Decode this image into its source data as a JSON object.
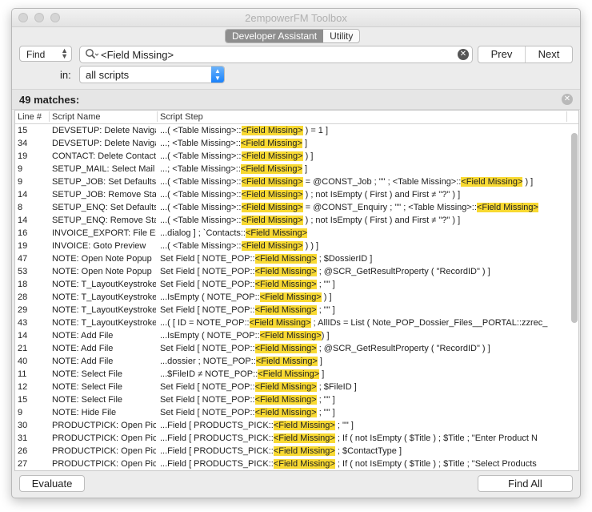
{
  "window": {
    "title": "2empowerFM Toolbox"
  },
  "tabs": [
    {
      "label": "Developer Assistant",
      "selected": true
    },
    {
      "label": "Utility",
      "selected": false
    }
  ],
  "find": {
    "mode": "Find",
    "query": "<Field Missing>",
    "prev_label": "Prev",
    "next_label": "Next",
    "in_label": "in:",
    "scope": "all scripts"
  },
  "results": {
    "count_label": "49 matches:",
    "columns": [
      "Line #",
      "Script Name",
      "Script Step"
    ],
    "highlight": "<Field Missing>",
    "highlight_color": "#f8d932",
    "rows": [
      {
        "line": "15",
        "name": "DEVSETUP: Delete Navigation",
        "step": "...( <Table Missing>::<Field Missing> ) = 1 ]"
      },
      {
        "line": "34",
        "name": "DEVSETUP: Delete Navigation",
        "step": "...; <Table Missing>::<Field Missing> ]"
      },
      {
        "line": "19",
        "name": "CONTACT: Delete Contact",
        "step": "...( <Table Missing>::<Field Missing> ) ]"
      },
      {
        "line": "9",
        "name": "SETUP_MAIL: Select Mail",
        "step": "...; <Table Missing>::<Field Missing> ]"
      },
      {
        "line": "9",
        "name": "SETUP_JOB: Set Defaults",
        "step": "...( <Table Missing>::<Field Missing> = @CONST_Job ; \"\" ; <Table Missing>::<Field Missing> ) ]"
      },
      {
        "line": "14",
        "name": "SETUP_JOB: Remove Status",
        "step": "...( <Table Missing>::<Field Missing> ) ; not IsEmpty ( First ) and First ≠ \"?\" ) ]"
      },
      {
        "line": "8",
        "name": "SETUP_ENQ: Set Defaults",
        "step": "...( <Table Missing>::<Field Missing> = @CONST_Enquiry ; \"\" ; <Table Missing>::<Field Missing>"
      },
      {
        "line": "14",
        "name": "SETUP_ENQ: Remove Status",
        "step": "...( <Table Missing>::<Field Missing> ) ; not IsEmpty ( First ) and First ≠ \"?\" ) ]"
      },
      {
        "line": "16",
        "name": "INVOICE_EXPORT: File Export",
        "step": "...dialog ] ; `Contacts::<Field Missing>"
      },
      {
        "line": "19",
        "name": "INVOICE: Goto Preview",
        "step": "...( <Table Missing>::<Field Missing> ) ) ]"
      },
      {
        "line": "47",
        "name": "NOTE: Open Note Popup",
        "step": "Set Field [ NOTE_POP::<Field Missing> ; $DossierID ]"
      },
      {
        "line": "53",
        "name": "NOTE: Open Note Popup",
        "step": "Set Field [ NOTE_POP::<Field Missing> ; @SCR_GetResultProperty ( \"RecordID\" ) ]"
      },
      {
        "line": "18",
        "name": "NOTE: T_LayoutKeystroke",
        "step": "Set Field [ NOTE_POP::<Field Missing> ; \"\" ]"
      },
      {
        "line": "28",
        "name": "NOTE: T_LayoutKeystroke",
        "step": "...IsEmpty ( NOTE_POP::<Field Missing> ) ]"
      },
      {
        "line": "29",
        "name": "NOTE: T_LayoutKeystroke",
        "step": "Set Field [ NOTE_POP::<Field Missing> ; \"\" ]"
      },
      {
        "line": "43",
        "name": "NOTE: T_LayoutKeystroke",
        "step": "...( [ ID = NOTE_POP::<Field Missing> ; AllIDs = List ( Note_POP_Dossier_Files__PORTAL::zzrec_"
      },
      {
        "line": "14",
        "name": "NOTE: Add File",
        "step": "...IsEmpty ( NOTE_POP::<Field Missing>) ]"
      },
      {
        "line": "21",
        "name": "NOTE: Add File",
        "step": "Set Field [ NOTE_POP::<Field Missing> ; @SCR_GetResultProperty ( \"RecordID\" ) ]"
      },
      {
        "line": "40",
        "name": "NOTE: Add File",
        "step": "...dossier ; NOTE_POP::<Field Missing> ]"
      },
      {
        "line": "11",
        "name": "NOTE: Select File",
        "step": "...$FileID ≠ NOTE_POP::<Field Missing> ]"
      },
      {
        "line": "12",
        "name": "NOTE: Select File",
        "step": "Set Field [ NOTE_POP::<Field Missing> ; $FileID ]"
      },
      {
        "line": "15",
        "name": "NOTE: Select File",
        "step": "Set Field [ NOTE_POP::<Field Missing> ; \"\" ]"
      },
      {
        "line": "9",
        "name": "NOTE: Hide File",
        "step": "Set Field [ NOTE_POP::<Field Missing> ; \"\" ]"
      },
      {
        "line": "30",
        "name": "PRODUCTPICK: Open Picker",
        "step": "...Field [ PRODUCTS_PICK::<Field Missing> ; \"\" ]"
      },
      {
        "line": "31",
        "name": "PRODUCTPICK: Open Picker",
        "step": "...Field [ PRODUCTS_PICK::<Field Missing> ; If ( not IsEmpty ( $Title ) ; $Title ; \"Enter Product N"
      },
      {
        "line": "26",
        "name": "PRODUCTPICK: Open Picker",
        "step": "...Field [ PRODUCTS_PICK::<Field Missing> ; $ContactType ]"
      },
      {
        "line": "27",
        "name": "PRODUCTPICK: Open Picker",
        "step": "...Field [ PRODUCTS_PICK::<Field Missing> ; If ( not IsEmpty ( $Title ) ; $Title ; \"Select Products"
      }
    ]
  },
  "footer": {
    "evaluate_label": "Evaluate",
    "findall_label": "Find All"
  }
}
